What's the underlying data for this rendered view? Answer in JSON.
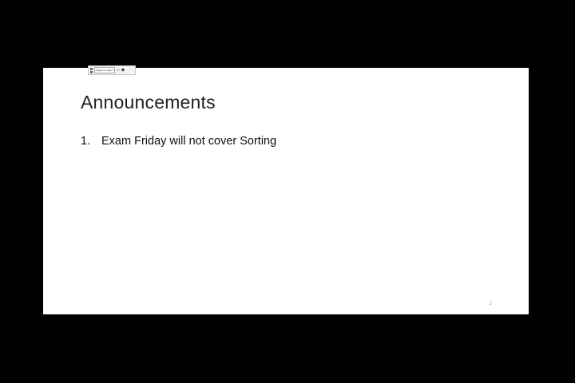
{
  "slide": {
    "title": "Announcements",
    "bullets": [
      {
        "number": "1.",
        "text": "Exam Friday will not cover Sorting"
      }
    ],
    "page_number": "2"
  },
  "mini_toolbar": {
    "font_name": "Segoe UI Light",
    "icons": [
      "bold-icon",
      "italic-icon",
      "font-dropdown",
      "brush-icon",
      "shape-icon"
    ]
  },
  "colors": {
    "background": "#000000",
    "slide": "#ffffff",
    "title_text": "#222222",
    "page_number": "#a0a0a0"
  }
}
